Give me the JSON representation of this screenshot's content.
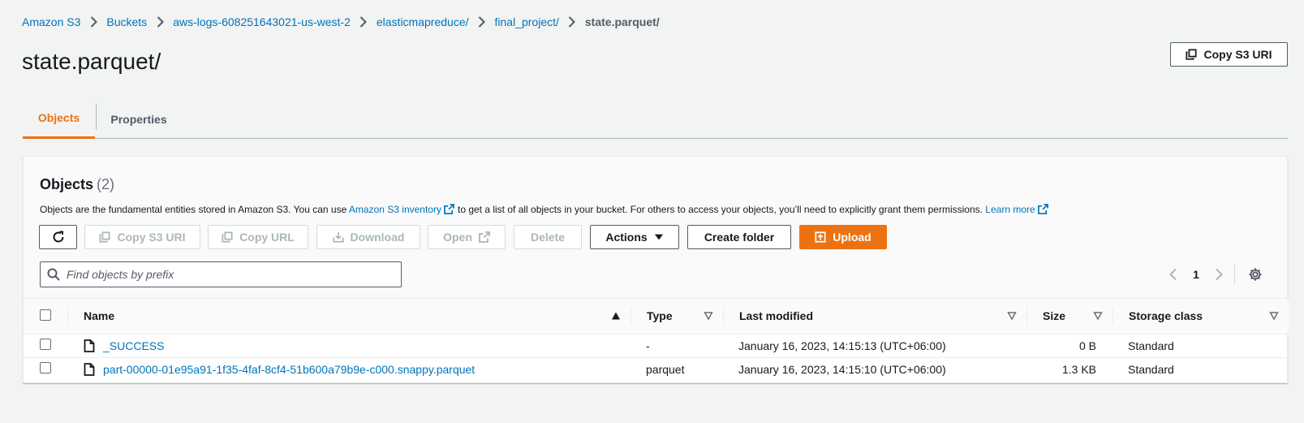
{
  "breadcrumb": {
    "items": [
      "Amazon S3",
      "Buckets",
      "aws-logs-608251643021-us-west-2",
      "elasticmapreduce/",
      "final_project/"
    ],
    "current": "state.parquet/"
  },
  "page": {
    "title": "state.parquet/",
    "copy_uri_label": "Copy S3 URI"
  },
  "tabs": [
    {
      "label": "Objects",
      "active": true
    },
    {
      "label": "Properties",
      "active": false
    }
  ],
  "objects_panel": {
    "title": "Objects",
    "count": "(2)",
    "description_1": "Objects are the fundamental entities stored in Amazon S3. You can use",
    "inventory_link": "Amazon S3 inventory",
    "description_2": "to get a list of all objects in your bucket. For others to access your objects, you’ll need to explicitly grant them permissions.",
    "learn_more": "Learn more"
  },
  "toolbar": {
    "refresh_icon": "refresh-icon",
    "copy_s3_uri": "Copy S3 URI",
    "copy_url": "Copy URL",
    "download": "Download",
    "open": "Open",
    "delete": "Delete",
    "actions": "Actions",
    "create_folder": "Create folder",
    "upload": "Upload"
  },
  "search": {
    "placeholder": "Find objects by prefix",
    "value": ""
  },
  "pagination": {
    "current_page": "1"
  },
  "table": {
    "columns": [
      "Name",
      "Type",
      "Last modified",
      "Size",
      "Storage class"
    ],
    "rows": [
      {
        "name": "_SUCCESS",
        "type": "-",
        "last_modified": "January 16, 2023, 14:15:13 (UTC+06:00)",
        "size": "0 B",
        "storage_class": "Standard"
      },
      {
        "name": "part-00000-01e95a91-1f35-4faf-8cf4-51b600a79b9e-c000.snappy.parquet",
        "type": "parquet",
        "last_modified": "January 16, 2023, 14:15:10 (UTC+06:00)",
        "size": "1.3 KB",
        "storage_class": "Standard"
      }
    ]
  },
  "colors": {
    "link": "#0073bb",
    "accent": "#ec7211",
    "text": "#16191f",
    "disabled": "#aab7b8",
    "background": "#f2f3f3"
  }
}
